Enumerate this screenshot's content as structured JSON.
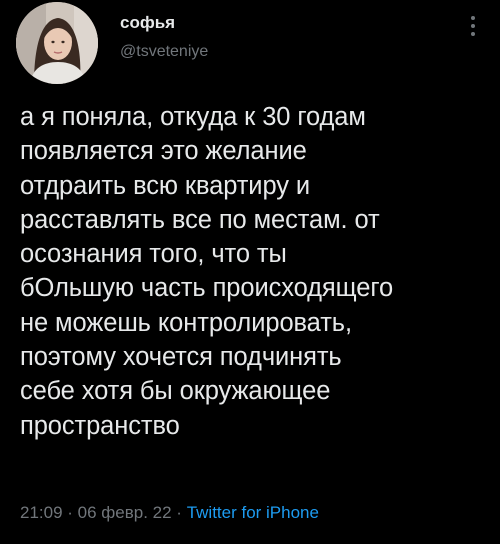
{
  "tweet": {
    "author": {
      "display_name": "софья",
      "handle": "@tsveteniye"
    },
    "text": "а я поняла, откуда к 30 годам\nпоявляется это желание\nотдраить всю квартиру и\nрасставлять все по местам. от\nосознания того, что ты\nбОльшую часть происходящего\nне можешь контролировать,\nпоэтому хочется подчинять\nсебе хотя бы окружающее\nпространство",
    "time": "21:09",
    "separator_1": " · ",
    "date": "06 февр. 22",
    "separator_2": " · ",
    "source": "Twitter for iPhone"
  },
  "icons": {
    "more": "more-vertical-icon",
    "avatar": "avatar"
  },
  "colors": {
    "background": "#000000",
    "primary_text": "#e7e9ea",
    "secondary_text": "#71767b",
    "link": "#1d9bf0"
  }
}
